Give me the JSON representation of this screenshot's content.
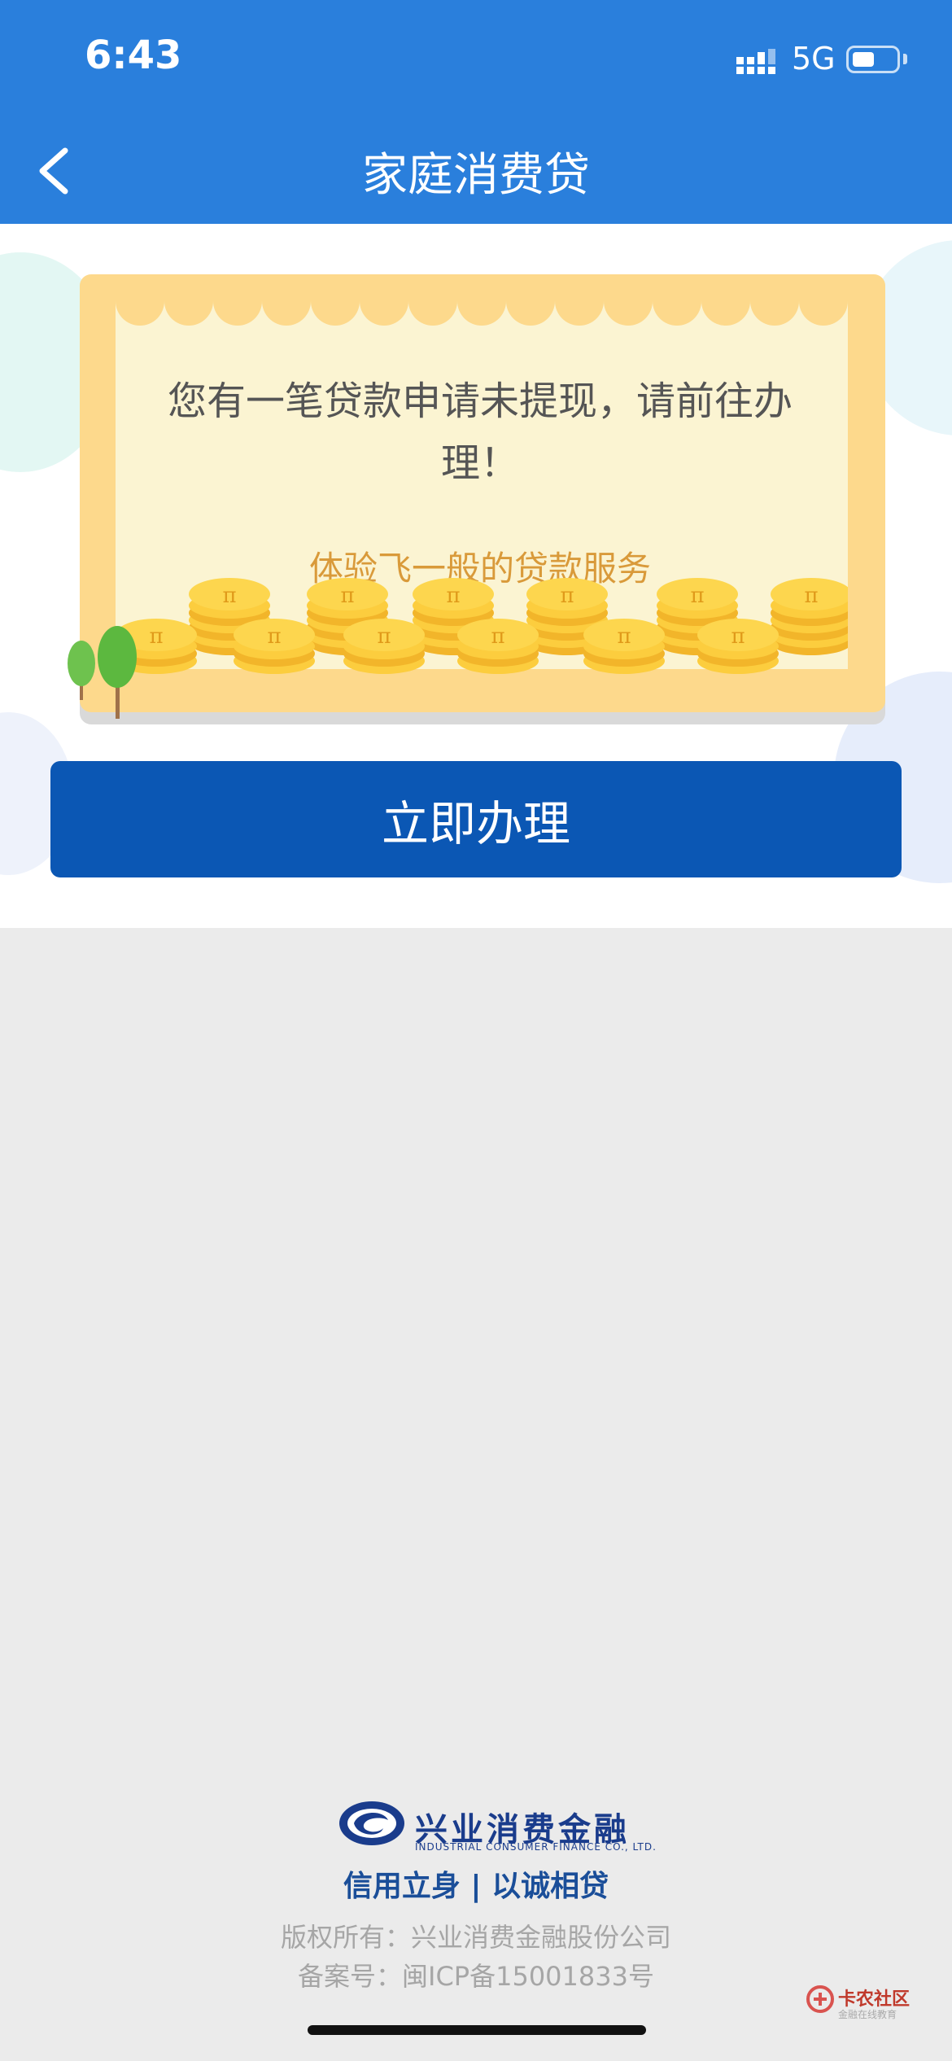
{
  "status_bar": {
    "time": "6:43",
    "network": "5G"
  },
  "nav": {
    "title": "家庭消费贷",
    "back_icon": "chevron-left-icon"
  },
  "card": {
    "message": "您有一笔贷款申请未提现，请前往办理！",
    "subtitle": "体验飞一般的贷款服务"
  },
  "action": {
    "label": "立即办理"
  },
  "footer": {
    "logo_text": "兴业消费金融",
    "logo_en": "INDUSTRIAL CONSUMER FINANCE CO., LTD.",
    "slogan": "信用立身 | 以诚相贷",
    "copyright": "版权所有：兴业消费金融股份公司",
    "icp": "备案号：闽ICP备15001833号"
  },
  "watermark": {
    "text": "卡农社区",
    "sub": "金融在线教育"
  },
  "colors": {
    "header": "#2a7fdc",
    "button": "#0b57b4",
    "card_border": "#fdd98c",
    "card_fill": "#fbf4d2",
    "subtitle": "#d99a3a",
    "brand": "#1a3c8c"
  }
}
